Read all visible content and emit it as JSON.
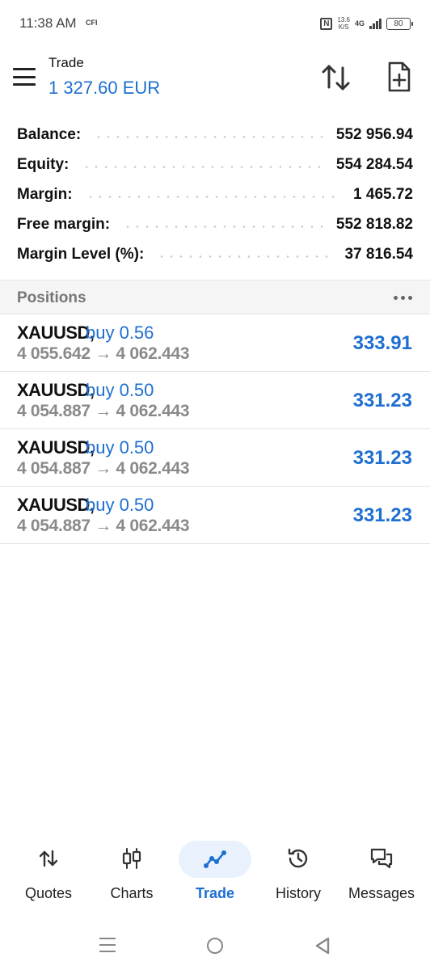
{
  "status_bar": {
    "time": "11:38 AM",
    "carrier": "CFI",
    "nfc_label": "N",
    "net_speed_value": "13.6",
    "net_speed_unit": "K/S",
    "network": "4G",
    "battery": "80"
  },
  "header": {
    "title": "Trade",
    "balance": "1 327.60 EUR"
  },
  "summary": [
    {
      "label": "Balance:",
      "value": "552 956.94"
    },
    {
      "label": "Equity:",
      "value": "554 284.54"
    },
    {
      "label": "Margin:",
      "value": "1 465.72"
    },
    {
      "label": "Free margin:",
      "value": "552 818.82"
    },
    {
      "label": "Margin Level (%):",
      "value": "37 816.54"
    }
  ],
  "positions": {
    "title": "Positions",
    "items": [
      {
        "symbol": "XAUUSD,",
        "side": "buy 0.56",
        "prices": "4 055.642 → 4 062.443",
        "profit": "333.91"
      },
      {
        "symbol": "XAUUSD,",
        "side": "buy 0.50",
        "prices": "4 054.887 → 4 062.443",
        "profit": "331.23"
      },
      {
        "symbol": "XAUUSD,",
        "side": "buy 0.50",
        "prices": "4 054.887 → 4 062.443",
        "profit": "331.23"
      },
      {
        "symbol": "XAUUSD,",
        "side": "buy 0.50",
        "prices": "4 054.887 → 4 062.443",
        "profit": "331.23"
      }
    ]
  },
  "bottom_nav": [
    {
      "label": "Quotes",
      "icon": "quotes-icon"
    },
    {
      "label": "Charts",
      "icon": "charts-icon"
    },
    {
      "label": "Trade",
      "icon": "trade-icon",
      "active": true
    },
    {
      "label": "History",
      "icon": "history-icon"
    },
    {
      "label": "Messages",
      "icon": "messages-icon"
    }
  ],
  "colors": {
    "accent": "#1e6fd0",
    "muted_text": "#8a8a8a",
    "section_bg": "#f5f5f5"
  }
}
